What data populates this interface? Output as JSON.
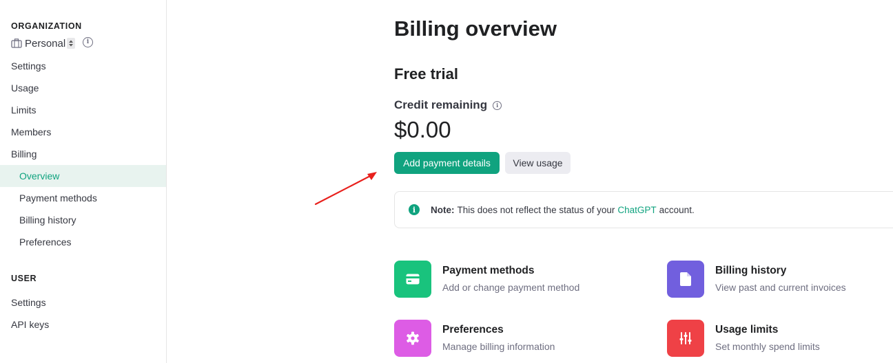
{
  "sidebar": {
    "org_heading": "ORGANIZATION",
    "org_name": "Personal",
    "org_items": [
      {
        "label": "Settings"
      },
      {
        "label": "Usage"
      },
      {
        "label": "Limits"
      },
      {
        "label": "Members"
      },
      {
        "label": "Billing"
      }
    ],
    "billing_sub": [
      {
        "label": "Overview",
        "active": true
      },
      {
        "label": "Payment methods"
      },
      {
        "label": "Billing history"
      },
      {
        "label": "Preferences"
      }
    ],
    "user_heading": "USER",
    "user_items": [
      {
        "label": "Settings"
      },
      {
        "label": "API keys"
      }
    ]
  },
  "main": {
    "title": "Billing overview",
    "plan": "Free trial",
    "credit_label": "Credit remaining",
    "credit_amount": "$0.00",
    "add_payment_label": "Add payment details",
    "view_usage_label": "View usage",
    "note": {
      "prefix": "Note:",
      "text_before": "This does not reflect the status of your",
      "link": "ChatGPT",
      "text_after": "account."
    },
    "cards": [
      {
        "title": "Payment methods",
        "desc": "Add or change payment method",
        "color": "#19c37d",
        "icon": "credit-card-icon"
      },
      {
        "title": "Billing history",
        "desc": "View past and current invoices",
        "color": "#715fde",
        "icon": "document-icon"
      },
      {
        "title": "Preferences",
        "desc": "Manage billing information",
        "color": "#dd5ce5",
        "icon": "gear-icon"
      },
      {
        "title": "Usage limits",
        "desc": "Set monthly spend limits",
        "color": "#ef4146",
        "icon": "sliders-icon"
      }
    ]
  },
  "colors": {
    "accent": "#10a37f",
    "annotation_arrow": "#e8201c"
  }
}
